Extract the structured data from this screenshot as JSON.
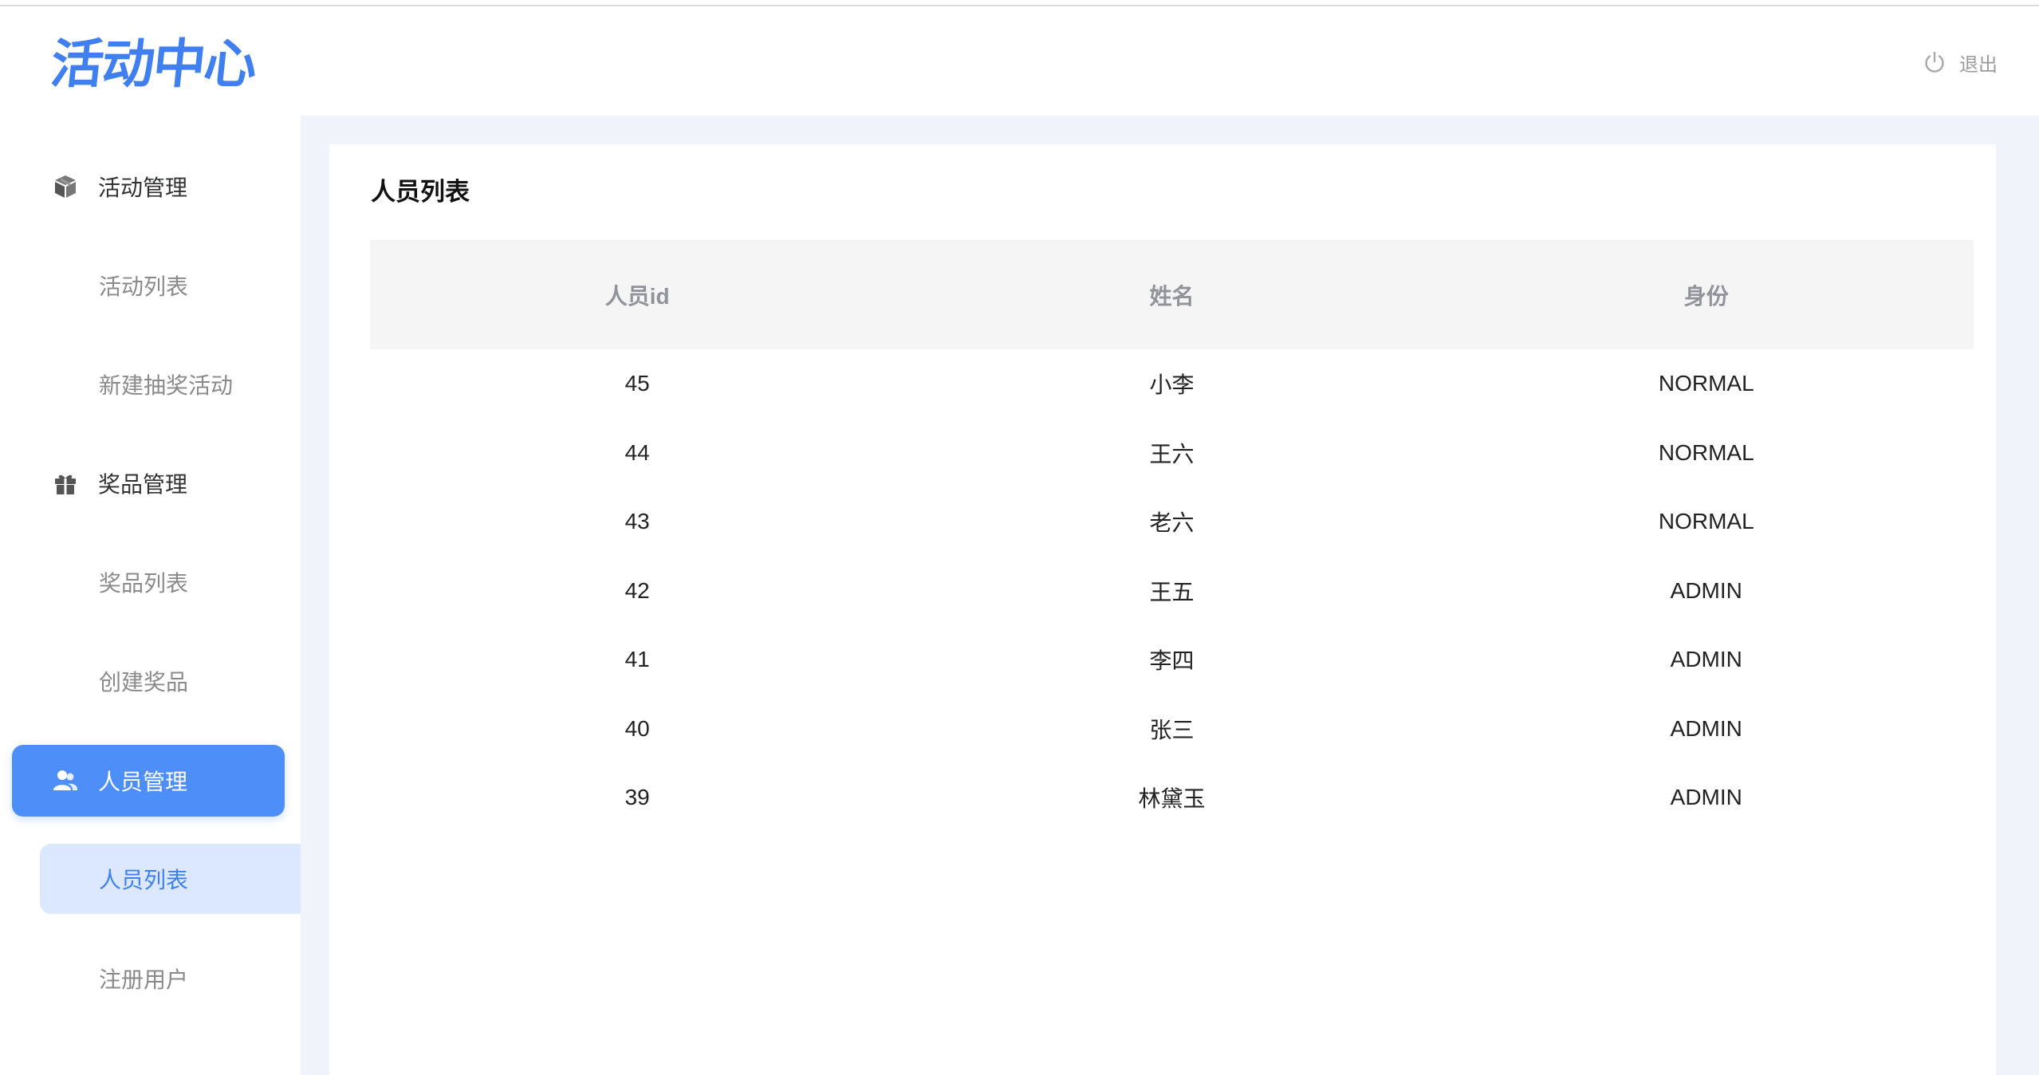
{
  "header": {
    "logo_text": "活动中心",
    "logout_label": "退出",
    "logout_icon": "power-icon"
  },
  "sidebar": {
    "groups": [
      {
        "label": "活动管理",
        "icon": "cube-icon",
        "active": false,
        "items": [
          {
            "label": "活动列表",
            "active": false
          },
          {
            "label": "新建抽奖活动",
            "active": false
          }
        ]
      },
      {
        "label": "奖品管理",
        "icon": "gift-icon",
        "active": false,
        "items": [
          {
            "label": "奖品列表",
            "active": false
          },
          {
            "label": "创建奖品",
            "active": false
          }
        ]
      },
      {
        "label": "人员管理",
        "icon": "users-icon",
        "active": true,
        "items": [
          {
            "label": "人员列表",
            "active": true
          },
          {
            "label": "注册用户",
            "active": false
          }
        ]
      }
    ]
  },
  "main": {
    "title": "人员列表",
    "table": {
      "columns": [
        "人员id",
        "姓名",
        "身份"
      ],
      "rows": [
        [
          "45",
          "小李",
          "NORMAL"
        ],
        [
          "44",
          "王六",
          "NORMAL"
        ],
        [
          "43",
          "老六",
          "NORMAL"
        ],
        [
          "42",
          "王五",
          "ADMIN"
        ],
        [
          "41",
          "李四",
          "ADMIN"
        ],
        [
          "40",
          "张三",
          "ADMIN"
        ],
        [
          "39",
          "林黛玉",
          "ADMIN"
        ]
      ]
    }
  },
  "colors": {
    "accent": "#4d8ef8",
    "active_submenu_bg": "#dbe8ff",
    "content_bg": "#f0f4fa",
    "table_header_bg": "#f5f5f5"
  }
}
